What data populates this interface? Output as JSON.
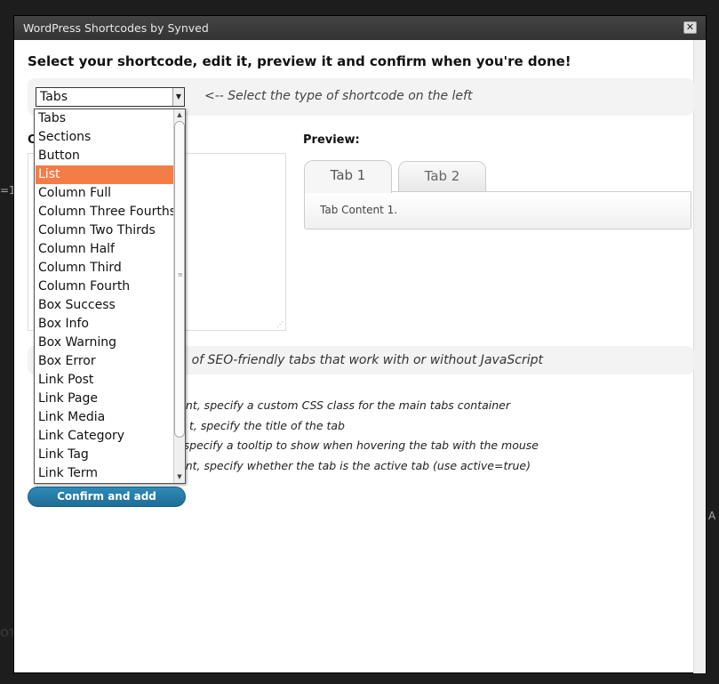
{
  "window": {
    "title": "WordPress Shortcodes by Synved",
    "close_label": "✕"
  },
  "background": {
    "left_text_1": "=1",
    "left_text_2": "OT",
    "right_text": "A"
  },
  "main": {
    "headline": "Select your shortcode, edit it, preview it and confirm when you're done!",
    "select": {
      "value": "Tabs",
      "hint": "<-- Select the type of shortcode on the left"
    },
    "code_label": "C",
    "preview_label": "Preview:",
    "preview": {
      "tabs": [
        "Tab 1",
        "Tab 2"
      ],
      "active_tab": "Tab 1",
      "content": "Tab Content 1."
    },
    "description": "of SEO-friendly tabs that work with or without JavaScript",
    "params": [
      "ent, specify a custom CSS class for the main tabs container",
      "t, specify the title of the tab",
      "specify a tooltip to show when hovering the tab with the mouse",
      "ent, specify whether the tab is the active tab (use active=true)"
    ],
    "confirm_label": "Confirm and add shortcode"
  },
  "dropdown": {
    "highlighted": "List",
    "options": [
      "Tabs",
      "Sections",
      "Button",
      "List",
      "Column Full",
      "Column Three Fourths",
      "Column Two Thirds",
      "Column Half",
      "Column Third",
      "Column Fourth",
      "Box Success",
      "Box Info",
      "Box Warning",
      "Box Error",
      "Link Post",
      "Link Page",
      "Link Media",
      "Link Category",
      "Link Tag",
      "Link Term"
    ]
  },
  "colors": {
    "highlight": "#f47c47",
    "button": "#2474a3"
  }
}
